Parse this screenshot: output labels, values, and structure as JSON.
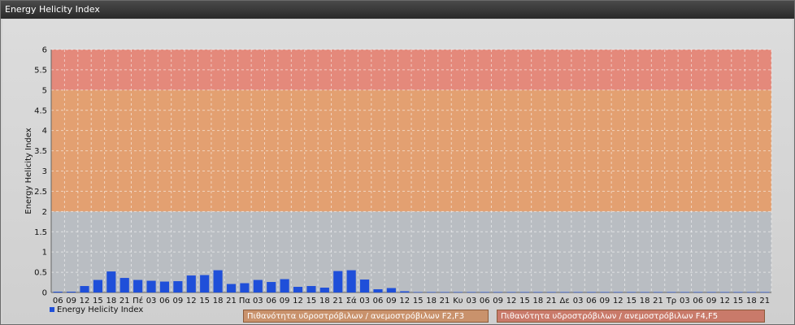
{
  "window": {
    "title": "Energy Helicity Index"
  },
  "legend": {
    "series_label": "Energy Helicity Index",
    "band_f23": "Πιθανότητα υδροστρόβιλων / ανεμοστρόβιλων F2,F3",
    "band_f45": "Πιθανότητα υδροστρόβιλων / ανεμοστρόβιλων F4,F5"
  },
  "colors": {
    "bar": "#1f4fd9",
    "band_low": "#b9bdc2",
    "band_mid": "#e3a071",
    "band_high": "#e4897b",
    "legend_f23": "#c9926c",
    "legend_f45": "#c97a6a"
  },
  "chart_data": {
    "type": "bar",
    "title": "",
    "xlabel": "",
    "ylabel": "Energy Helicity Index",
    "ylim": [
      0,
      6
    ],
    "yticks": [
      0,
      0.5,
      1,
      1.5,
      2,
      2.5,
      3,
      3.5,
      4,
      4.5,
      5,
      5.5,
      6
    ],
    "grid": true,
    "legend_position": "bottom",
    "categories": [
      "06",
      "09",
      "12",
      "15",
      "18",
      "21",
      "Πέ",
      "03",
      "06",
      "09",
      "12",
      "15",
      "18",
      "21",
      "Πα",
      "03",
      "06",
      "09",
      "12",
      "15",
      "18",
      "21",
      "Σά",
      "03",
      "06",
      "09",
      "12",
      "15",
      "18",
      "21",
      "Κυ",
      "03",
      "06",
      "09",
      "12",
      "15",
      "18",
      "21",
      "Δε",
      "03",
      "06",
      "09",
      "12",
      "15",
      "18",
      "21",
      "Τρ",
      "03",
      "06",
      "09",
      "12",
      "15",
      "18",
      "21"
    ],
    "series": [
      {
        "name": "Energy Helicity Index",
        "values": [
          0.02,
          0.02,
          0.16,
          0.31,
          0.52,
          0.36,
          0.31,
          0.29,
          0.27,
          0.28,
          0.42,
          0.43,
          0.55,
          0.21,
          0.23,
          0.31,
          0.26,
          0.33,
          0.14,
          0.16,
          0.12,
          0.53,
          0.55,
          0.32,
          0.08,
          0.11,
          0.03,
          0.01,
          0.01,
          0.01,
          0.01,
          0.01,
          0.01,
          0.01,
          0.01,
          0.01,
          0.01,
          0.01,
          0.01,
          0.01,
          0.01,
          0.01,
          0.01,
          0.01,
          0.01,
          0.01,
          0.01,
          0.01,
          0.01,
          0.01,
          0.01,
          0.01,
          0.01,
          0.01
        ]
      }
    ],
    "bands": [
      {
        "from": 0,
        "to": 2,
        "color": "#b9bdc2"
      },
      {
        "from": 2,
        "to": 5,
        "color": "#e3a071"
      },
      {
        "from": 5,
        "to": 6,
        "color": "#e4897b"
      }
    ]
  }
}
